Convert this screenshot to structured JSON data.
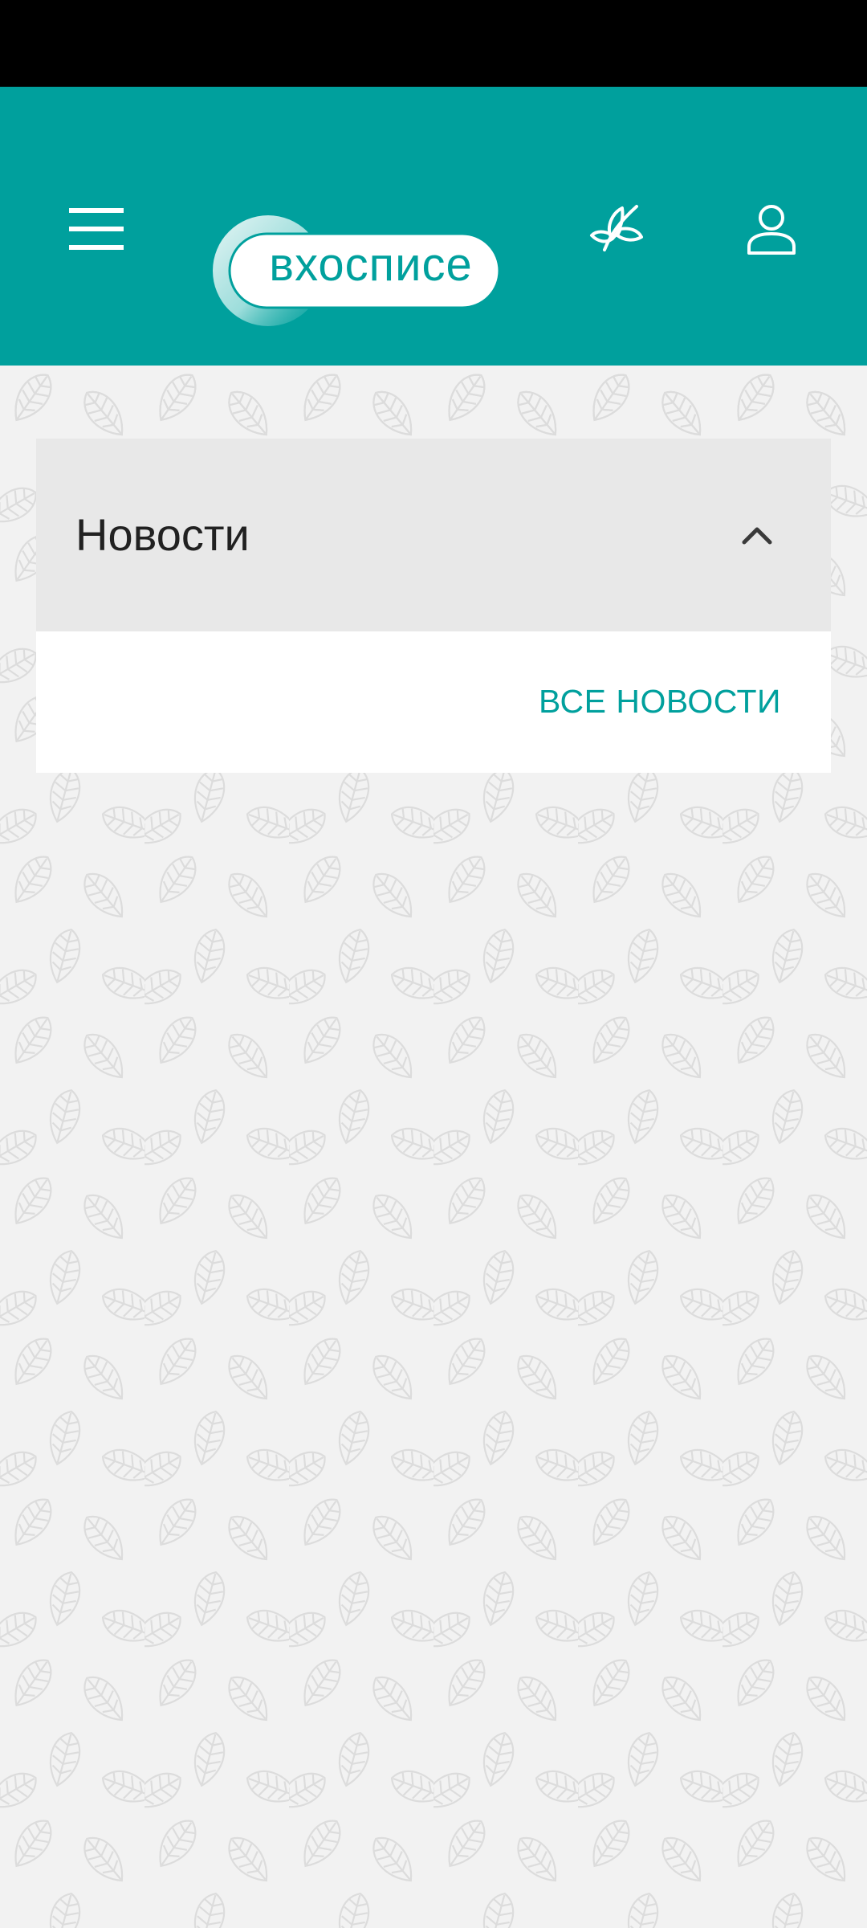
{
  "app": {
    "brand_color": "#00a09d",
    "logo_text": "вхосписе"
  },
  "header": {
    "icons": [
      "menu-icon",
      "butterfly-icon",
      "profile-icon"
    ]
  },
  "news": {
    "title": "Новости",
    "state": "expanded",
    "all_news_label": "ВСЕ НОВОСТИ"
  }
}
